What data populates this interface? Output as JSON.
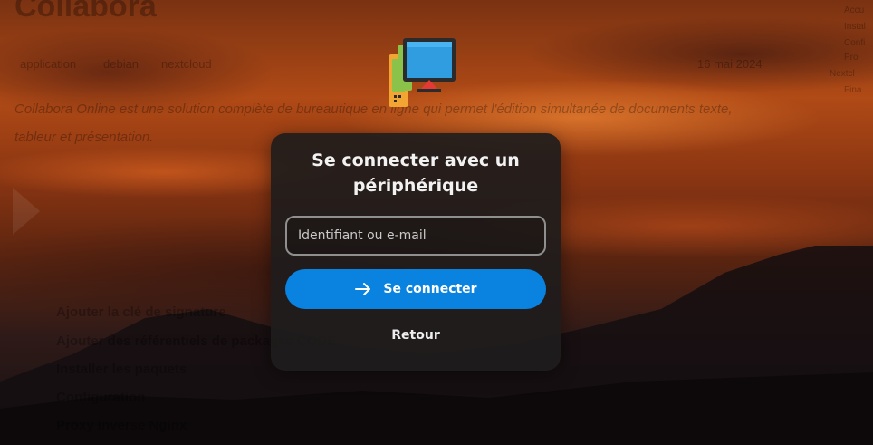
{
  "background_page": {
    "title": "Collabora",
    "tags": [
      "application",
      "debian",
      "nextcloud"
    ],
    "date": "16 mai 2024",
    "intro_line_1": "Collabora Online est une solution complète de bureautique en ligne qui permet l'édition simultanée de documents texte,",
    "intro_line_2": "tableur et présentation.",
    "toc": [
      "Ajouter la clé de signature",
      "Ajouter des référentiels de packages CODE",
      "Installer les paquets",
      "Configuration",
      "Proxy inverse Nginx"
    ],
    "sidebar": [
      "Accu",
      "Instal",
      "Confi",
      "Pro",
      "Nextcl",
      "Fina"
    ]
  },
  "login": {
    "title": "Se connecter avec un périphérique",
    "input_placeholder": "Identifiant ou e-mail",
    "input_value": "",
    "connect_label": "Se connecter",
    "back_label": "Retour"
  },
  "colors": {
    "accent": "#0a82e0",
    "card": "#1e1c1c",
    "logo_blue": "#2f9de0",
    "logo_green": "#8bc34a",
    "logo_orange": "#f2a533",
    "logo_red": "#e53935"
  },
  "icons": {
    "logo": "device-login-logo-icon",
    "connect": "arrow-right-icon"
  }
}
